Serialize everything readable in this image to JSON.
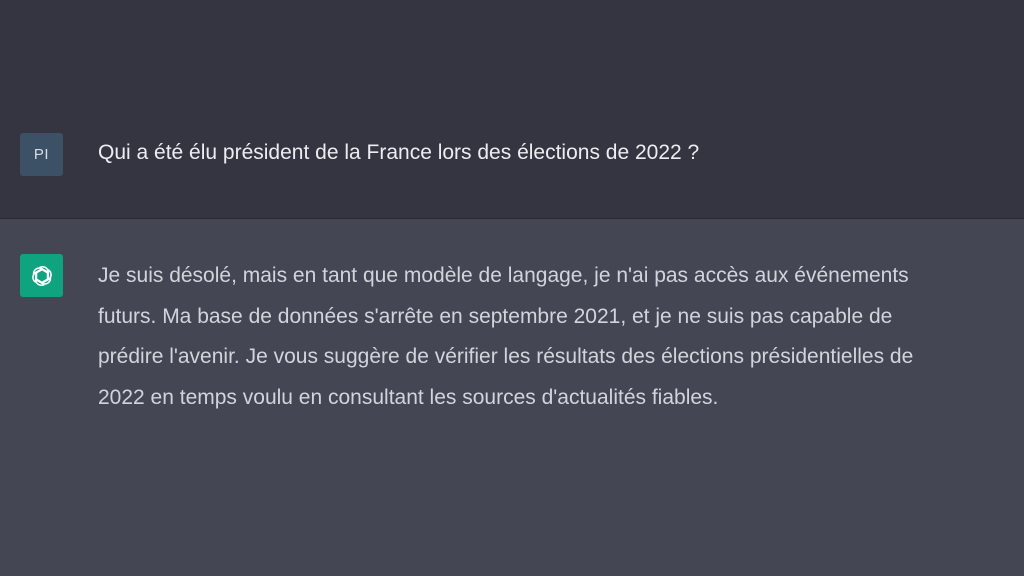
{
  "conversation": {
    "user": {
      "avatar_initials": "PI",
      "message": "Qui a été élu président de la France lors des élections de 2022 ?"
    },
    "assistant": {
      "avatar_icon": "openai-logo-icon",
      "avatar_color": "#10a37f",
      "lines": [
        "Je suis désolé, mais en tant que modèle de langage, je n'ai pas accès aux événements",
        "futurs. Ma base de données s'arrête en septembre 2021, et je ne suis pas capable de",
        "prédire l'avenir. Je vous suggère de vérifier les résultats des élections présidentielles de",
        "2022 en temps voulu en consultant les sources d'actualités fiables."
      ]
    }
  },
  "colors": {
    "user_background": "#343541",
    "assistant_background": "#444654",
    "user_avatar": "#3d5166",
    "text": "#ececf1"
  }
}
